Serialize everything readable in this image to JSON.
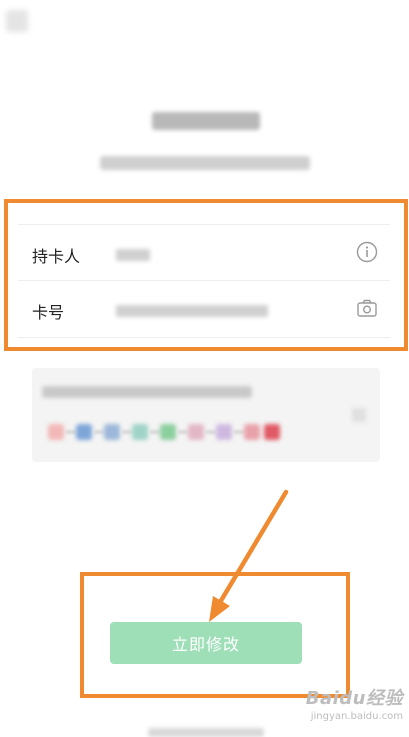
{
  "form": {
    "holder_label": "持卡人",
    "card_number_label": "卡号"
  },
  "submit": {
    "label": "立即修改"
  },
  "watermark": {
    "main": "Baidu经验",
    "sub": "jingyan.baidu.com"
  },
  "colors": {
    "highlight": "#f08a30",
    "submit_bg": "#9edfb8",
    "info_bg": "#f4f4f4"
  },
  "icons": {
    "holder_info": "info-circle-icon",
    "card_scan": "camera-icon",
    "back": "back-arrow-icon"
  }
}
